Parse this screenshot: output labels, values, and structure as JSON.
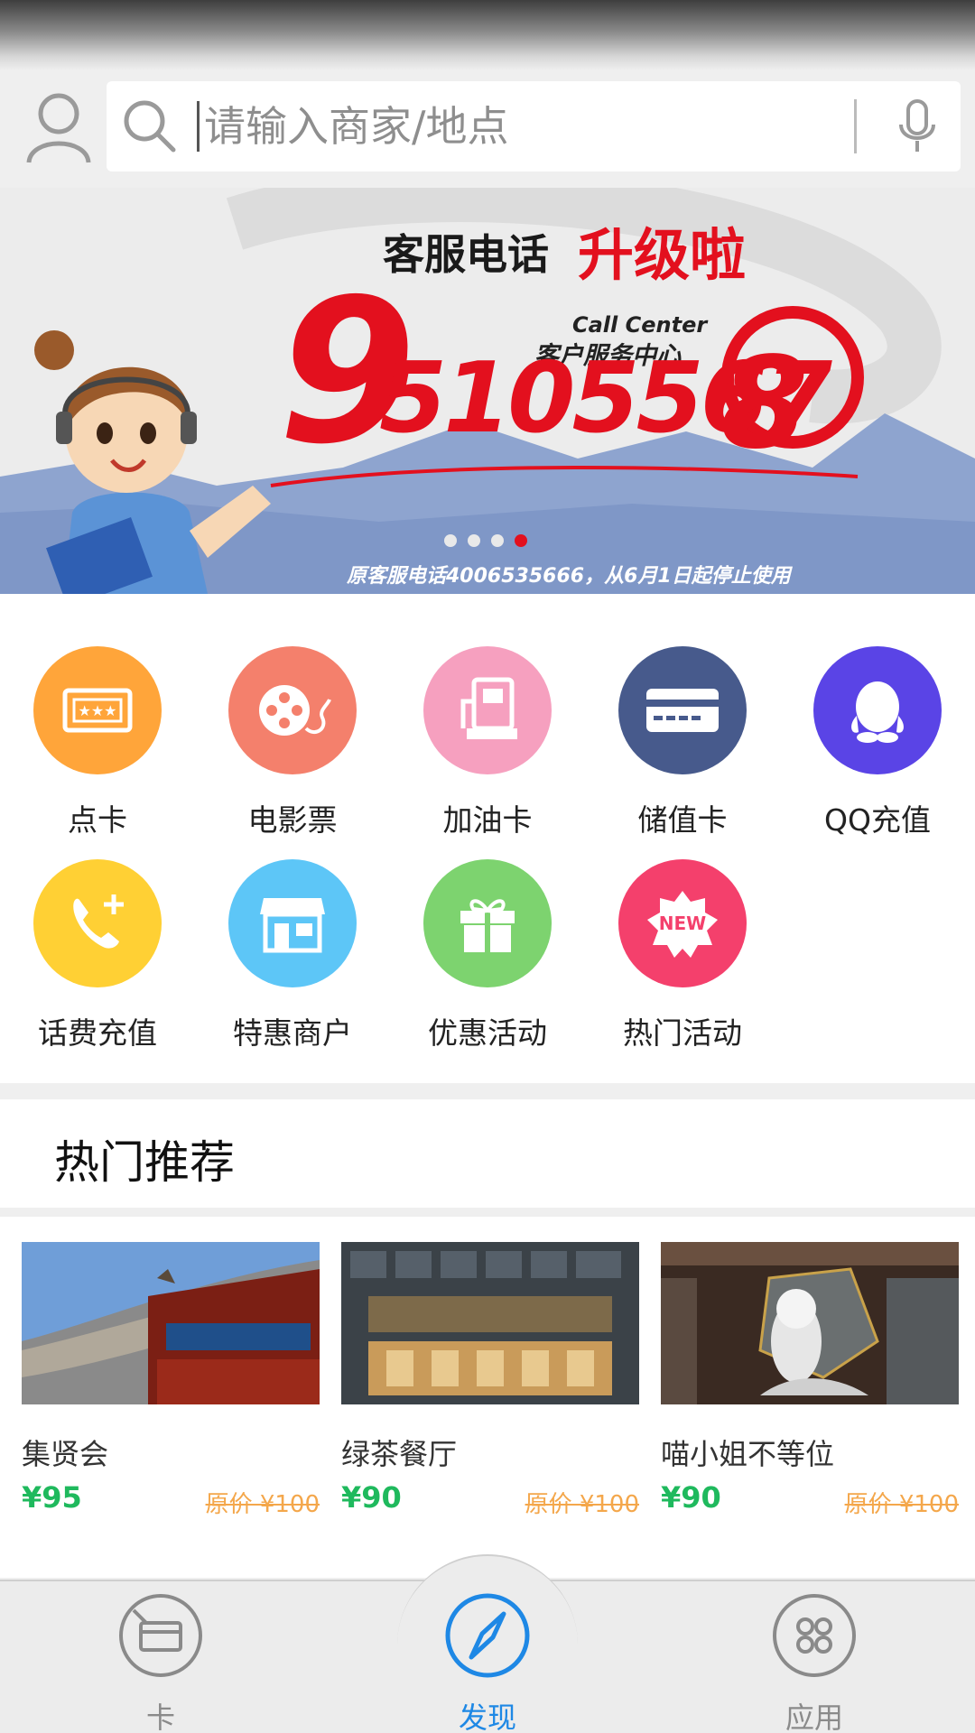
{
  "search": {
    "placeholder": "请输入商家/地点"
  },
  "banner": {
    "title_prefix": "客服电话",
    "title_highlight": "升级啦",
    "subtitle_en": "Call Center",
    "subtitle_cn": "客户服务中心",
    "phone_first": "9",
    "phone_middle": "5105567",
    "phone_last": "8",
    "footer": "原客服电话4006535666，从6月1日起停止使用",
    "dots_total": 4,
    "active_dot": 4
  },
  "categories": [
    {
      "label": "点卡",
      "icon": "ticket-icon",
      "color": "#ffa53a"
    },
    {
      "label": "电影票",
      "icon": "film-reel-icon",
      "color": "#f4806c"
    },
    {
      "label": "加油卡",
      "icon": "fuel-pump-icon",
      "color": "#f6a0bf"
    },
    {
      "label": "储值卡",
      "icon": "credit-card-icon",
      "color": "#475a8c"
    },
    {
      "label": "QQ充值",
      "icon": "qq-penguin-icon",
      "color": "#5a44e6"
    },
    {
      "label": "话费充值",
      "icon": "phone-add-icon",
      "color": "#ffd034"
    },
    {
      "label": "特惠商户",
      "icon": "storefront-icon",
      "color": "#5dc6f7"
    },
    {
      "label": "优惠活动",
      "icon": "gift-icon",
      "color": "#7dd36f"
    },
    {
      "label": "热门活动",
      "icon": "new-badge-icon",
      "color": "#f4406c"
    }
  ],
  "new_badge_text": "NEW",
  "hot": {
    "title": "热门推荐",
    "items": [
      {
        "name": "集贤会",
        "price": "¥95",
        "original": "原价 ¥100"
      },
      {
        "name": "绿茶餐厅",
        "price": "¥90",
        "original": "原价 ¥100"
      },
      {
        "name": "喵小姐不等位",
        "price": "¥90",
        "original": "原价 ¥100"
      }
    ]
  },
  "nav": {
    "card": "卡",
    "discover": "发现",
    "apps": "应用"
  },
  "colors": {
    "accent": "#1e88e5",
    "price": "#1fb95d",
    "original_price": "#f4a74b",
    "banner_red": "#e3101e"
  }
}
